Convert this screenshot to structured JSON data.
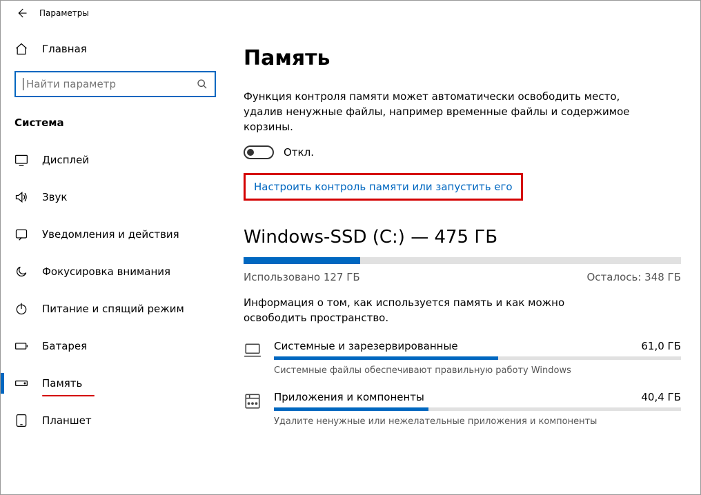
{
  "titlebar": {
    "title": "Параметры"
  },
  "sidebar": {
    "home": "Главная",
    "search_placeholder": "Найти параметр",
    "group": "Система",
    "items": [
      {
        "label": "Дисплей"
      },
      {
        "label": "Звук"
      },
      {
        "label": "Уведомления и действия"
      },
      {
        "label": "Фокусировка внимания"
      },
      {
        "label": "Питание и спящий режим"
      },
      {
        "label": "Батарея"
      },
      {
        "label": "Память",
        "selected": true
      },
      {
        "label": "Планшет"
      }
    ]
  },
  "content": {
    "title": "Память",
    "description": "Функция контроля памяти может автоматически освободить место, удалив ненужные файлы, например временные файлы и содержимое корзины.",
    "toggle_state": "Откл.",
    "config_link": "Настроить контроль памяти или запустить его",
    "drive": {
      "title": "Windows-SSD (C:) — 475 ГБ",
      "used_label": "Использовано 127 ГБ",
      "remaining_label": "Осталось: 348 ГБ",
      "used_percent": 26.7,
      "description": "Информация о том, как используется память и как можно освободить пространство."
    },
    "categories": [
      {
        "name": "Системные и зарезервированные",
        "size": "61,0 ГБ",
        "percent": 55,
        "sub": "Системные файлы обеспечивают правильную работу Windows"
      },
      {
        "name": "Приложения и компоненты",
        "size": "40,4 ГБ",
        "percent": 38,
        "sub": "Удалите ненужные или нежелательные приложения и компоненты"
      }
    ]
  }
}
